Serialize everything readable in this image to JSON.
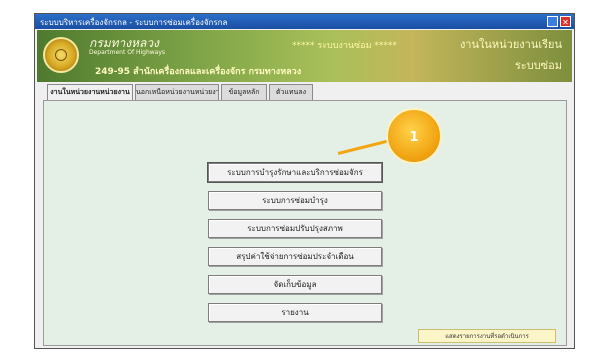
{
  "window": {
    "title": "ระบบบริหารเครื่องจักรกล - ระบบการซ่อมเครื่องจักรกล",
    "minimize_glyph": "_",
    "close_glyph": "✕"
  },
  "banner": {
    "org_name_th": "กรมทางหลวง",
    "org_name_en": "Department Of Highways",
    "address": "249-95 สำนักเครื่องกลและเครื่องจักร กรมทางหลวง",
    "center_title": "***** ระบบงานซ่อม *****",
    "system_title": "งานในหน่วยงานเรียน",
    "system_subtitle": "ระบบซ่อม"
  },
  "tabs": [
    {
      "label": "งานในหน่วยงานหน่วยงาน",
      "active": true
    },
    {
      "label": "นอกเหนือหน่วยงานหน่วยงาน",
      "active": false
    },
    {
      "label": "ข้อมูลหลัก",
      "active": false
    },
    {
      "label": "ตัวแทนลง",
      "active": false
    }
  ],
  "menu_buttons": [
    {
      "label": "ระบบการบำรุงรักษาและบริการซ่อมจักร",
      "selected": true
    },
    {
      "label": "ระบบการซ่อมบำรุง",
      "selected": false
    },
    {
      "label": "ระบบการซ่อมปรับปรุงสภาพ",
      "selected": false
    },
    {
      "label": "สรุปค่าใช้จ่ายการซ่อมประจำเดือน",
      "selected": false
    },
    {
      "label": "จัดเก็บข้อมูล",
      "selected": false
    },
    {
      "label": "รายงาน",
      "selected": false
    }
  ],
  "report_button": {
    "label": "แสดงรายการงานที่รอดำเนินการ"
  },
  "callout": {
    "number": "1"
  },
  "colors": {
    "titlebar": "#1a4ea3",
    "panel_bg": "#e4f0e6",
    "callout": "#f2a614",
    "banner_green": "#7ea447"
  }
}
